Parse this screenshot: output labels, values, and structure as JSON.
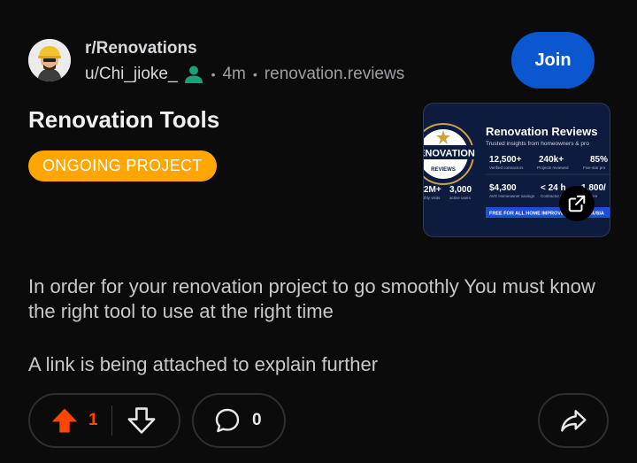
{
  "post": {
    "subreddit": "r/Renovations",
    "author": "u/Chi_jioke_",
    "age": "4m",
    "domain": "renovation.reviews",
    "join_label": "Join",
    "title": "Renovation Tools",
    "flair": "ONGOING PROJECT",
    "body": [
      "In order for your renovation project to go smoothly You must know the right tool to use at the right time",
      "A link is being attached to explain further"
    ],
    "upvotes": "1",
    "comments": "0"
  },
  "thumbnail": {
    "seal_text": "RENOVATION",
    "seal_sub": "REVIEWS",
    "heading": "Renovation Reviews",
    "subheading": "Trusted insights from homeowners & pro",
    "stats": [
      {
        "value": "12,500+",
        "label": "Verified contractors"
      },
      {
        "value": "240k+",
        "label": "Projects reviewed"
      },
      {
        "value": "85%",
        "label": "Five-star pro"
      },
      {
        "value": "$4,300",
        "label": "AVG Homeowner savings"
      },
      {
        "value": "< 24 h",
        "label": "Contractor response"
      },
      {
        "value": "1,800/",
        "label": "Q&A thre"
      }
    ],
    "left_stats": [
      {
        "value": "2M+",
        "label": "thly visits"
      },
      {
        "value": "3,000",
        "label": "active users"
      }
    ],
    "banner": "FREE FOR ALL HOME IMPROVEMENT ENTHUSIA"
  },
  "colors": {
    "upvote": "#ff4500",
    "join": "#0a57d0",
    "flair": "#ffa600",
    "online": "#1aa179"
  },
  "icons": {
    "upvote": "arrow-up-icon",
    "downvote": "arrow-down-icon",
    "comment": "comment-bubble-icon",
    "share": "share-arrow-icon",
    "external": "external-link-icon",
    "user": "user-icon"
  }
}
